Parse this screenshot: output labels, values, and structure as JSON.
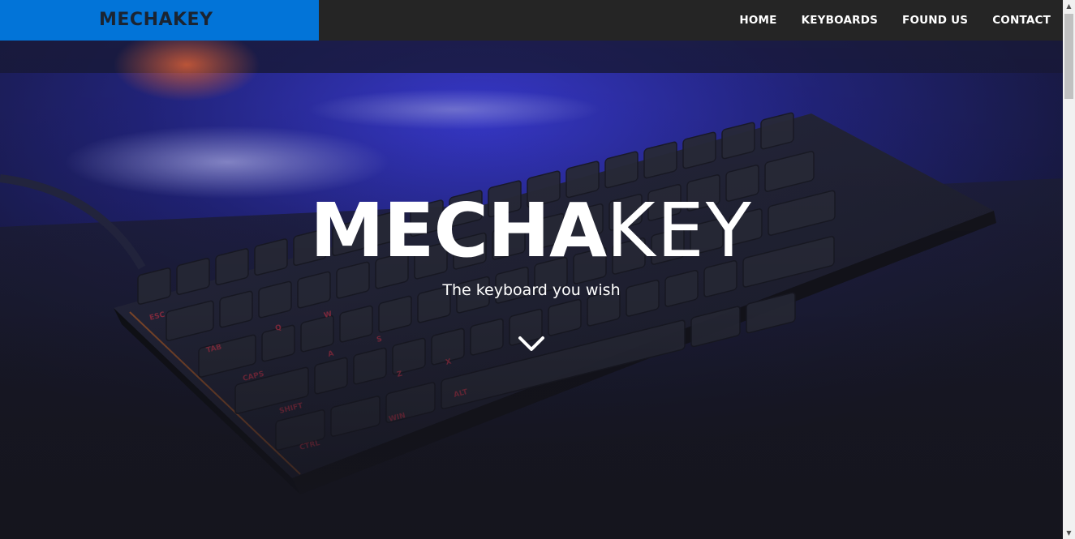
{
  "brand": {
    "name": "MECHAKEY"
  },
  "nav": {
    "items": [
      {
        "label": "HOME"
      },
      {
        "label": "KEYBOARDS"
      },
      {
        "label": "FOUND US"
      },
      {
        "label": "CONTACT"
      }
    ]
  },
  "hero": {
    "title_bold": "MECHA",
    "title_light": "KEY",
    "subtitle": "The keyboard you wish",
    "scroll_icon": "chevron-down-icon"
  },
  "colors": {
    "brand_bg": "#0274d8",
    "navbar_bg": "#252525",
    "brand_text": "#1b2431",
    "hero_text": "#ffffff"
  }
}
